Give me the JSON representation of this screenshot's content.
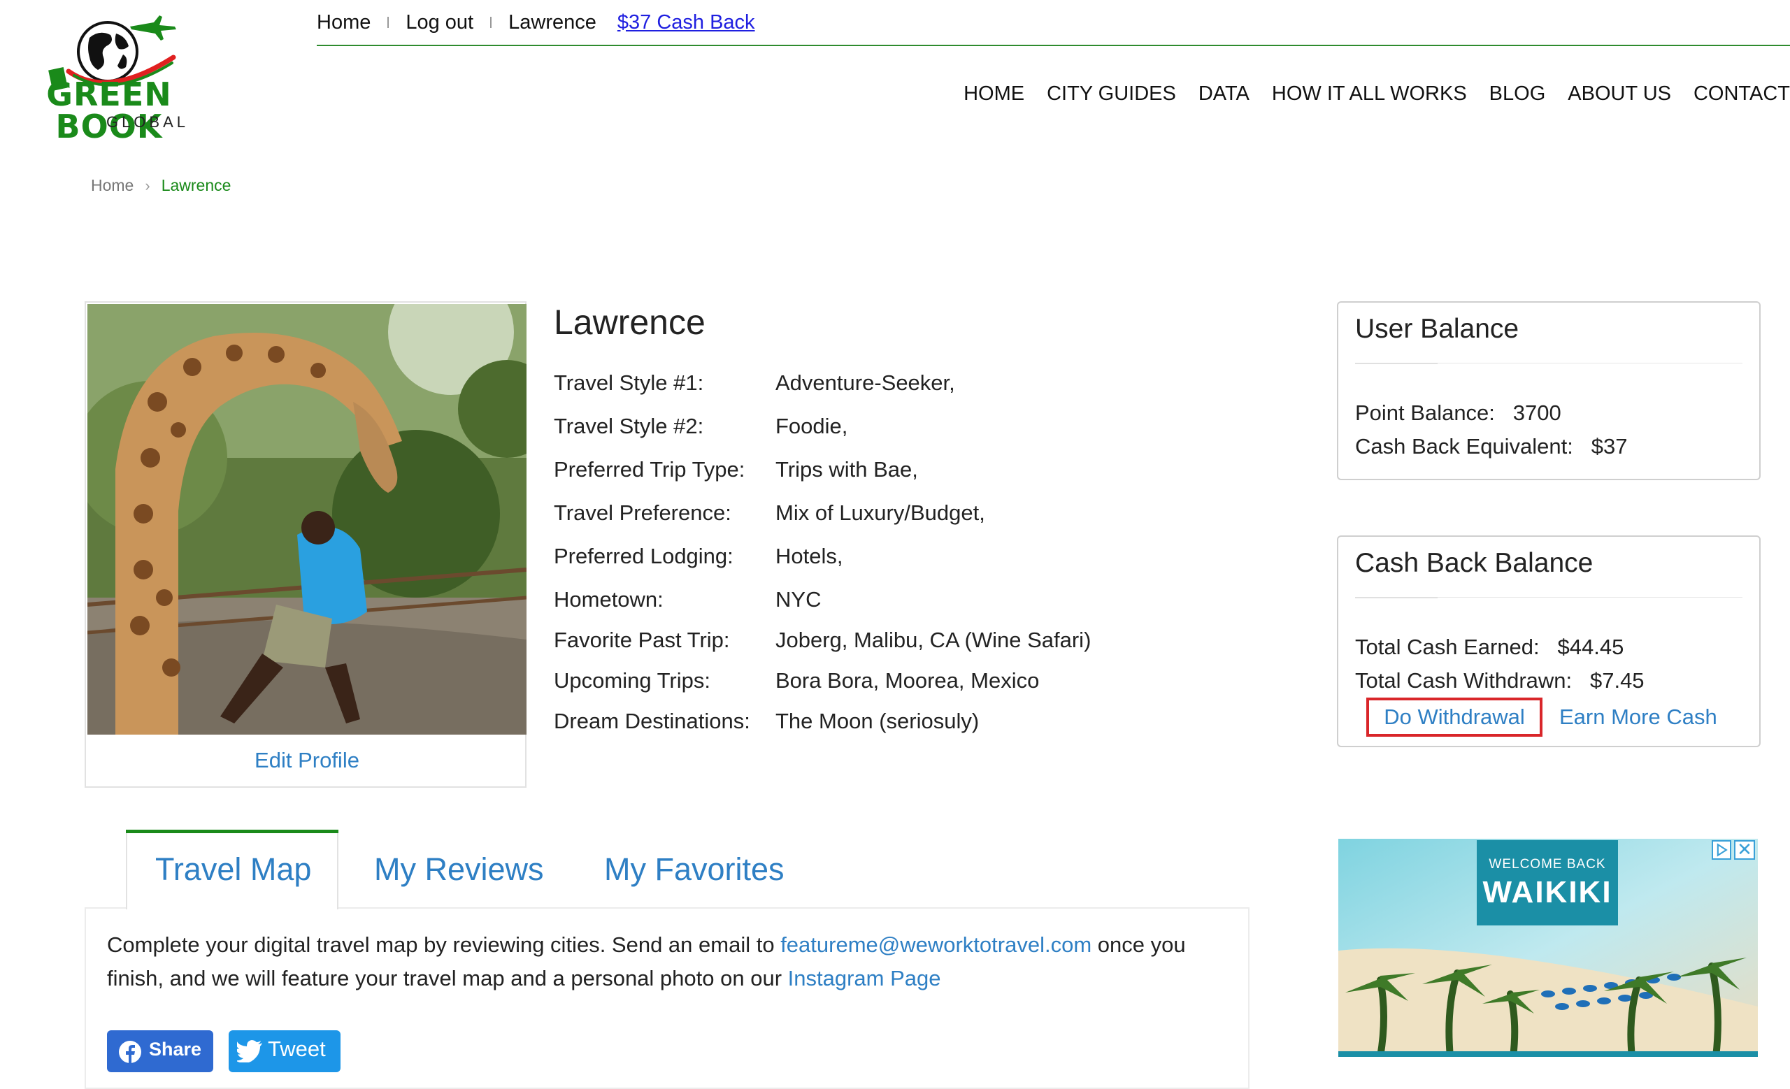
{
  "logo": {
    "name": "GREEN BOOK",
    "sub": "GLOBAL"
  },
  "topbar": {
    "home": "Home",
    "logout": "Log out",
    "user": "Lawrence",
    "cash_back": "$37 Cash Back"
  },
  "nav": {
    "items": [
      "HOME",
      "CITY GUIDES",
      "DATA",
      "HOW IT ALL WORKS",
      "BLOG",
      "ABOUT US",
      "CONTACT"
    ]
  },
  "breadcrumb": {
    "home": "Home",
    "current": "Lawrence"
  },
  "profile": {
    "name": "Lawrence",
    "edit_label": "Edit Profile",
    "rows": [
      {
        "label": "Travel Style #1:",
        "value": "Adventure-Seeker,"
      },
      {
        "label": "Travel Style #2:",
        "value": "Foodie,"
      },
      {
        "label": "Preferred Trip Type:",
        "value": "Trips with Bae,"
      },
      {
        "label": "Travel Preference:",
        "value": "Mix of Luxury/Budget,"
      },
      {
        "label": "Preferred Lodging:",
        "value": "Hotels,"
      },
      {
        "label": "Hometown:",
        "value": "NYC"
      },
      {
        "label": "Favorite Past Trip:",
        "value": "Joberg, Malibu, CA (Wine Safari)"
      },
      {
        "label": "Upcoming Trips:",
        "value": "Bora Bora, Moorea, Mexico"
      },
      {
        "label": "Dream Destinations:",
        "value": "The Moon (seriosuly)"
      }
    ]
  },
  "user_balance": {
    "title": "User Balance",
    "point_label": "Point Balance:",
    "point_value": "3700",
    "equiv_label": "Cash Back Equivalent:",
    "equiv_value": "$37"
  },
  "cashback_balance": {
    "title": "Cash Back Balance",
    "earned_label": "Total Cash Earned:",
    "earned_value": "$44.45",
    "withdrawn_label": "Total Cash Withdrawn:",
    "withdrawn_value": "$7.45",
    "withdraw_button": "Do Withdrawal",
    "earn_more": "Earn More Cash"
  },
  "ad": {
    "small": "WELCOME BACK",
    "big": "WAIKIKI",
    "close": "✕"
  },
  "tabs": [
    {
      "label": "Travel Map"
    },
    {
      "label": "My Reviews"
    },
    {
      "label": "My Favorites"
    }
  ],
  "panel": {
    "text1": "Complete your digital travel map by reviewing cities. Send an email to ",
    "email": "featureme@weworktotravel.com",
    "text2": " once you finish, and we will feature your travel map and a personal photo on our ",
    "instagram": "Instagram Page"
  },
  "social": {
    "share": "Share",
    "tweet": "Tweet"
  },
  "colors": {
    "brand_green": "#1a8a1a",
    "link_blue": "#2e7fc4",
    "highlight_red": "#d9262a"
  }
}
